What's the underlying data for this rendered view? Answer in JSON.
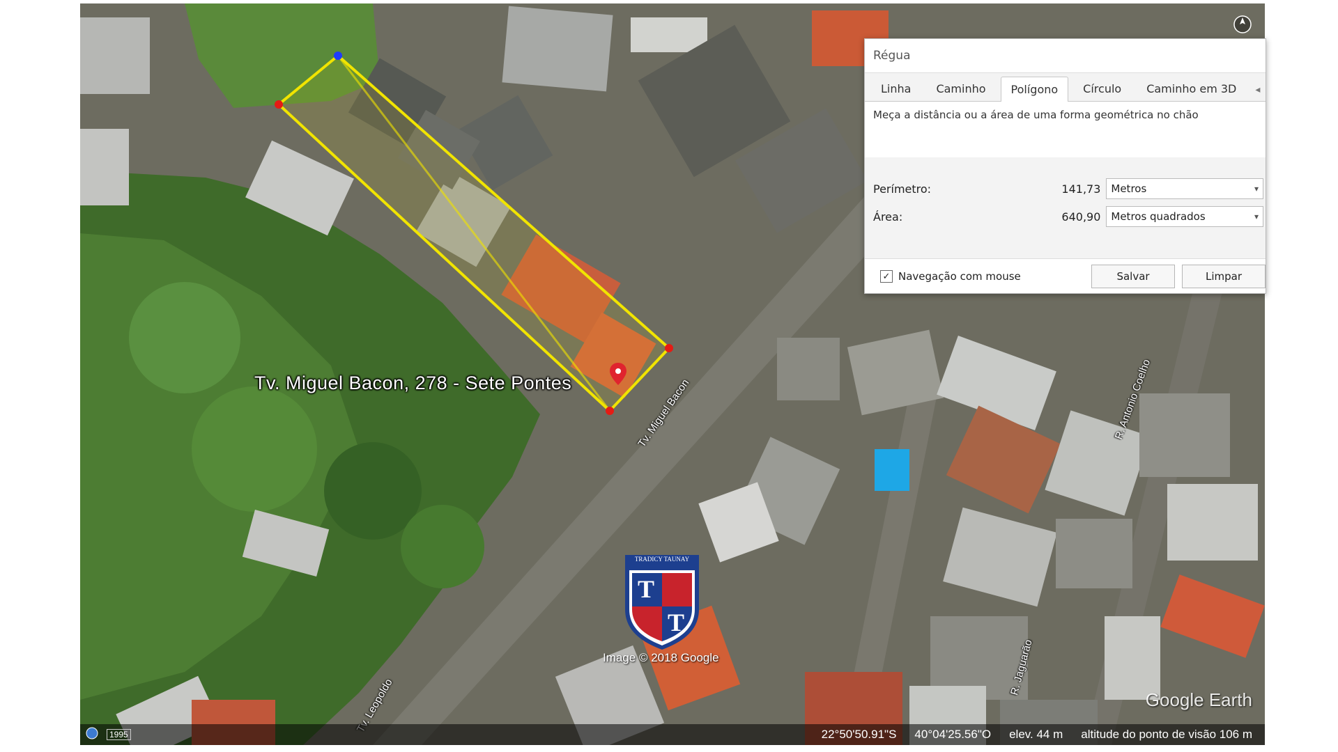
{
  "map": {
    "place_label": "Tv. Miguel Bacon, 278 - Sete Pontes",
    "imagery_credit": "Image © 2018 Google",
    "watermark_text": "TRADICY TAUNAY",
    "watermark_letter": "T",
    "google_mark": "Google Earth",
    "street_labels": [
      "Tv. Miguel Bacon",
      "Tv. Leopoldo",
      "R. Jaguarão",
      "R. Antonio Coelho"
    ]
  },
  "status_bar": {
    "left_tag": "1995",
    "latitude": "22°50'50.91\"S",
    "longitude": "40°04'25.56\"O",
    "elevation": "elev. 44 m",
    "eye_altitude": "altitude do ponto de visão 106 m"
  },
  "ruler": {
    "title": "Régua",
    "tabs": [
      "Linha",
      "Caminho",
      "Polígono",
      "Círculo",
      "Caminho em 3D"
    ],
    "active_tab": 2,
    "description": "Meça a distância ou a área de uma forma geométrica no chão",
    "perimeter_label": "Perímetro:",
    "perimeter_value": "141,73",
    "perimeter_unit": "Metros",
    "area_label": "Área:",
    "area_value": "640,90",
    "area_unit": "Metros quadrados",
    "mouse_nav_label": "Navegação com mouse",
    "mouse_nav_checked": true,
    "save_label": "Salvar",
    "clear_label": "Limpar"
  },
  "colors": {
    "polygon_stroke": "#f1e400",
    "vertex": "#e51b14",
    "vertex_active": "#1f3cff",
    "foliage": "#3f6b2a",
    "road": "#7b7a70"
  }
}
